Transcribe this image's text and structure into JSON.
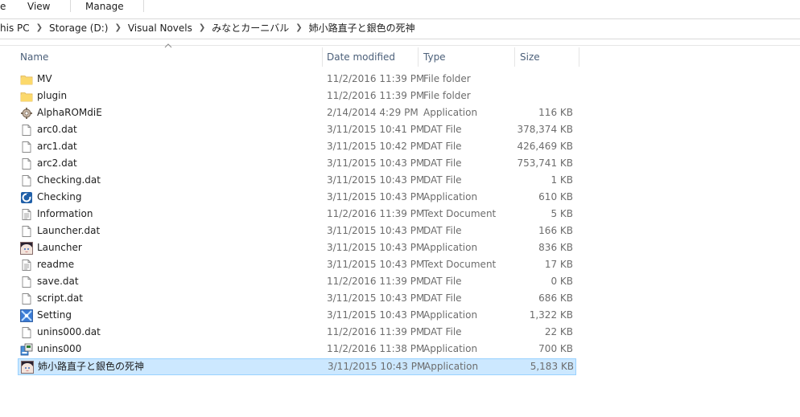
{
  "ribbon": {
    "tabs": [
      "e",
      "View",
      "Manage"
    ]
  },
  "address": {
    "crumbs": [
      "his PC",
      "Storage (D:)",
      "Visual Novels",
      "みなとカーニバル",
      "姉小路直子と銀色の死神"
    ]
  },
  "columns": {
    "name": "Name",
    "date": "Date modified",
    "type": "Type",
    "size": "Size"
  },
  "files": [
    {
      "name": "MV",
      "date": "11/2/2016 11:39 PM",
      "type": "File folder",
      "size": "",
      "icon": "folder-icon"
    },
    {
      "name": "plugin",
      "date": "11/2/2016 11:39 PM",
      "type": "File folder",
      "size": "",
      "icon": "folder-icon"
    },
    {
      "name": "AlphaROMdiE",
      "date": "2/14/2014 4:29 PM",
      "type": "Application",
      "size": "116 KB",
      "icon": "gear-app-icon"
    },
    {
      "name": "arc0.dat",
      "date": "3/11/2015 10:41 PM",
      "type": "DAT File",
      "size": "378,374 KB",
      "icon": "blank-file-icon"
    },
    {
      "name": "arc1.dat",
      "date": "3/11/2015 10:42 PM",
      "type": "DAT File",
      "size": "426,469 KB",
      "icon": "blank-file-icon"
    },
    {
      "name": "arc2.dat",
      "date": "3/11/2015 10:43 PM",
      "type": "DAT File",
      "size": "753,741 KB",
      "icon": "blank-file-icon"
    },
    {
      "name": "Checking.dat",
      "date": "3/11/2015 10:43 PM",
      "type": "DAT File",
      "size": "1 KB",
      "icon": "blank-file-icon"
    },
    {
      "name": "Checking",
      "date": "3/11/2015 10:43 PM",
      "type": "Application",
      "size": "610 KB",
      "icon": "checking-app-icon"
    },
    {
      "name": "Information",
      "date": "11/2/2016 11:39 PM",
      "type": "Text Document",
      "size": "5 KB",
      "icon": "text-document-icon"
    },
    {
      "name": "Launcher.dat",
      "date": "3/11/2015 10:43 PM",
      "type": "DAT File",
      "size": "166 KB",
      "icon": "blank-file-icon"
    },
    {
      "name": "Launcher",
      "date": "3/11/2015 10:43 PM",
      "type": "Application",
      "size": "836 KB",
      "icon": "character-app-icon"
    },
    {
      "name": "readme",
      "date": "3/11/2015 10:43 PM",
      "type": "Text Document",
      "size": "17 KB",
      "icon": "text-document-icon"
    },
    {
      "name": "save.dat",
      "date": "11/2/2016 11:39 PM",
      "type": "DAT File",
      "size": "0 KB",
      "icon": "blank-file-icon"
    },
    {
      "name": "script.dat",
      "date": "3/11/2015 10:43 PM",
      "type": "DAT File",
      "size": "686 KB",
      "icon": "blank-file-icon"
    },
    {
      "name": "Setting",
      "date": "3/11/2015 10:43 PM",
      "type": "Application",
      "size": "1,322 KB",
      "icon": "settings-app-icon"
    },
    {
      "name": "unins000.dat",
      "date": "11/2/2016 11:39 PM",
      "type": "DAT File",
      "size": "22 KB",
      "icon": "blank-file-icon"
    },
    {
      "name": "unins000",
      "date": "11/2/2016 11:38 PM",
      "type": "Application",
      "size": "700 KB",
      "icon": "uninstaller-icon"
    },
    {
      "name": "姉小路直子と銀色の死神",
      "date": "3/11/2015 10:43 PM",
      "type": "Application",
      "size": "5,183 KB",
      "icon": "character-app-icon",
      "selected": true
    }
  ]
}
